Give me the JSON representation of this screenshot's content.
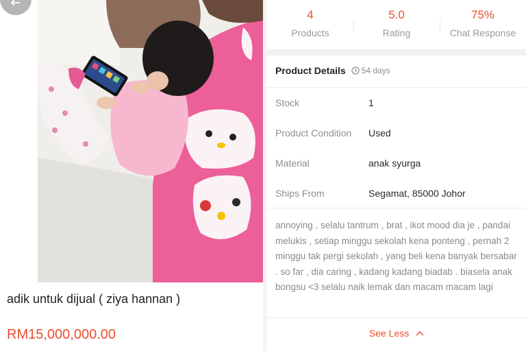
{
  "listing": {
    "title": "adik untuk dijual ( ziya hannan )",
    "price": "RM15,000,000.00",
    "photo_description": "Photo of a toddler in pink pajamas sitting on a bed holding a smartphone, next to a pink Hello Kitty pillow"
  },
  "shop_stats": [
    {
      "value": "4",
      "label": "Products"
    },
    {
      "value": "5.0",
      "label": "Rating"
    },
    {
      "value": "75%",
      "label": "Chat Response"
    }
  ],
  "details": {
    "title": "Product Details",
    "age": "54 days",
    "rows": [
      {
        "label": "Stock",
        "value": "1"
      },
      {
        "label": "Product Condition",
        "value": "Used"
      },
      {
        "label": "Material",
        "value": "anak syurga"
      },
      {
        "label": "Ships From",
        "value": "Segamat, 85000 Johor"
      }
    ],
    "description": "annoying , selalu tantrum , brat , ikot mood dia je , pandai melukis , setiap minggu sekolah kena ponteng , pernah 2 minggu tak pergi sekolah , yang beli kena banyak bersabar . so far , dia caring , kadang kadang biadab . biasela anak bongsu <3 selalu naik lemak dan macam macam lagi",
    "see_less": "See Less"
  },
  "colors": {
    "accent": "#ee4d2d",
    "muted": "#9a9a9a",
    "text": "#222222"
  },
  "icons": [
    "back-arrow-icon",
    "clock-icon",
    "chevron-up-icon"
  ]
}
